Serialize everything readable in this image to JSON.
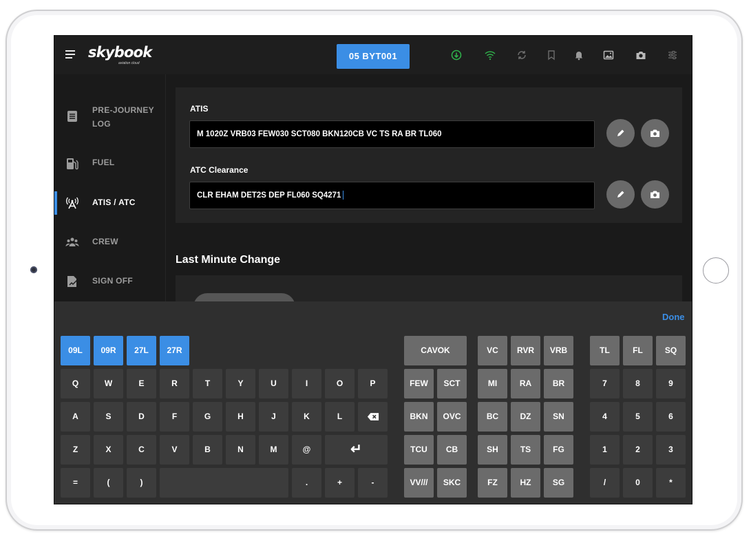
{
  "app": {
    "logo": "skybook",
    "logo_sub": "aviation cloud",
    "flight_button": "05 BYT001",
    "top_icons": [
      "download-icon",
      "wifi-icon",
      "sync-icon",
      "bookmark-icon",
      "bell-icon",
      "gallery-icon",
      "camera-icon",
      "settings-sliders-icon"
    ],
    "accent_color": "#3b8ee5",
    "download_color": "#2fae4a",
    "wifi_color": "#2fae4a"
  },
  "sidebar": {
    "items": [
      {
        "label": "PRE-JOURNEY",
        "label2": "LOG",
        "icon": "journal-icon"
      },
      {
        "label": "FUEL",
        "icon": "fuel-icon"
      },
      {
        "label": "ATIS / ATC",
        "icon": "antenna-icon",
        "active": true
      },
      {
        "label": "CREW",
        "icon": "crew-icon"
      },
      {
        "label": "SIGN OFF",
        "icon": "sign-off-icon"
      }
    ]
  },
  "main": {
    "atis_label": "ATIS",
    "atis_value": "M 1020Z VRB03 FEW030 SCT080 BKN120CB VC TS RA BR TL060",
    "atc_label": "ATC Clearance",
    "atc_value": "CLR EHAM DET2S DEP FL060 SQ4271",
    "section_title": "Last Minute Change"
  },
  "keyboard": {
    "done_label": "Done",
    "runway_keys": [
      "09L",
      "09R",
      "27L",
      "27R"
    ],
    "alpha_rows": [
      [
        "Q",
        "W",
        "E",
        "R",
        "T",
        "Y",
        "U",
        "I",
        "O",
        "P"
      ],
      [
        "A",
        "S",
        "D",
        "F",
        "G",
        "H",
        "J",
        "K",
        "L"
      ],
      [
        "Z",
        "X",
        "C",
        "V",
        "B",
        "N",
        "M",
        "@"
      ],
      [
        "=",
        "(",
        ")",
        ".",
        "+",
        "-"
      ]
    ],
    "enter_glyph": "↵",
    "cavok": "CAVOK",
    "cloud_keys": [
      [
        "FEW",
        "SCT"
      ],
      [
        "BKN",
        "OVC"
      ],
      [
        "TCU",
        "CB"
      ],
      [
        "VV///",
        "SKC"
      ]
    ],
    "wx_keys": [
      [
        "VC",
        "RVR",
        "VRB"
      ],
      [
        "MI",
        "RA",
        "BR"
      ],
      [
        "BC",
        "DZ",
        "SN"
      ],
      [
        "SH",
        "TS",
        "FG"
      ],
      [
        "FZ",
        "HZ",
        "SG"
      ]
    ],
    "num_keys": [
      [
        "TL",
        "FL",
        "SQ"
      ],
      [
        "7",
        "8",
        "9"
      ],
      [
        "4",
        "5",
        "6"
      ],
      [
        "1",
        "2",
        "3"
      ],
      [
        "/",
        "0",
        "*"
      ]
    ]
  }
}
